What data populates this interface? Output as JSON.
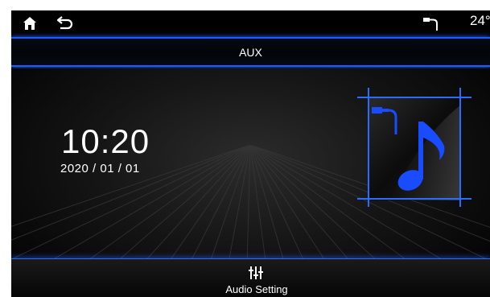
{
  "status_bar": {
    "temperature": "24°",
    "icons": [
      "home-icon",
      "back-icon",
      "aux-plug-icon"
    ]
  },
  "header": {
    "title": "AUX"
  },
  "clock": {
    "time": "10:20",
    "date": "2020 / 01 / 01"
  },
  "source_art": {
    "icon": "music-note-icon",
    "accent": "#1a4cff"
  },
  "bottom_bar": {
    "audio_setting_label": "Audio Setting",
    "icon": "equalizer-icon"
  },
  "colors": {
    "accent": "#1a5cff",
    "background": "#0a0a0a",
    "text": "#ffffff"
  }
}
